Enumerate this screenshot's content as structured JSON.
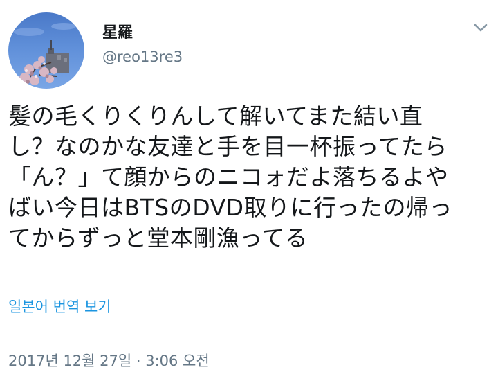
{
  "user": {
    "display_name": "星羅",
    "handle": "@reo13re3",
    "avatar_icon": "profile-photo-flowers-sky"
  },
  "menu": {
    "caret_icon": "chevron-down-icon"
  },
  "tweet": {
    "lines": [
      "髪の毛くりくりんして解いてまた結い直",
      "し？なのかな友達と手を目一杯振ってたら",
      "「ん？」て顔からのニコォだよ落ちるよや",
      "ばい今日はBTSのDVD取りに行ったの帰っ",
      "てからずっと堂本剛漁ってる"
    ],
    "translate_label": "일본어 번역 보기",
    "timestamp": "2017년 12월 27일 · 3:06 오전"
  },
  "colors": {
    "link": "#1b95e0",
    "secondary": "#657786",
    "text": "#14171a"
  }
}
